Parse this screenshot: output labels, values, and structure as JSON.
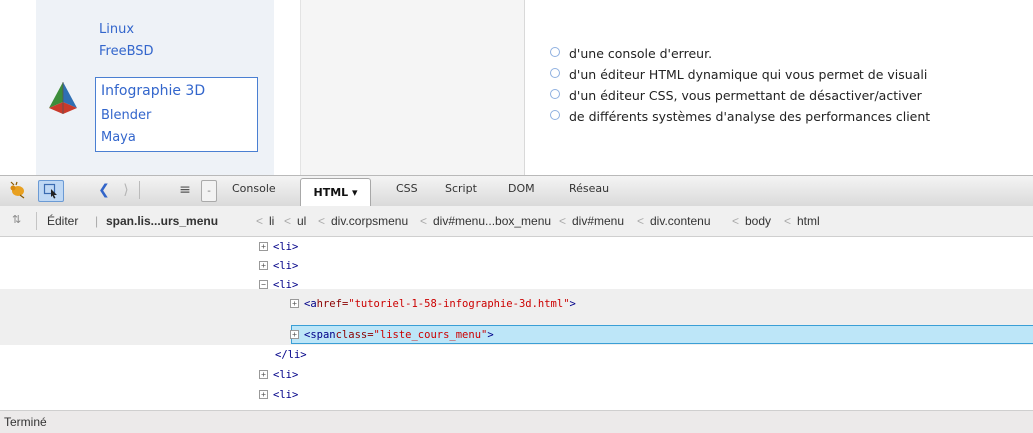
{
  "page": {
    "left_menu": {
      "items_above": [
        "Linux",
        "FreeBSD"
      ],
      "category": {
        "title": "Infographie 3D",
        "items": [
          "Blender",
          "Maya"
        ]
      }
    },
    "bullets": [
      "d'une console d'erreur.",
      "d'un éditeur HTML dynamique qui vous permet de visuali",
      "d'un éditeur CSS, vous permettant de désactiver/activer",
      "de différents systèmes d'analyse des performances client"
    ]
  },
  "toolbar": {
    "tabs": {
      "console": "Console",
      "html": "HTML ▾",
      "css": "CSS",
      "script": "Script",
      "dom": "DOM",
      "network": "Réseau"
    }
  },
  "breadcrumb": {
    "edit": "Éditer",
    "items": [
      "span.lis...urs_menu",
      "li",
      "ul",
      "div.corpsmenu",
      "div#menu...box_menu",
      "div#menu",
      "div.contenu",
      "body",
      "html"
    ]
  },
  "tree": {
    "rows": [
      {
        "type": "collapsed",
        "text": "<li>"
      },
      {
        "type": "collapsed",
        "text": "<li>"
      },
      {
        "type": "expanded",
        "text": "<li>"
      },
      {
        "type": "child",
        "tag_open": "<a ",
        "attr_name": "href=",
        "attr_value": "\"tutoriel-1-58-infographie-3d.html\"",
        "tag_close": ">"
      },
      {
        "type": "child_selected",
        "tag_open": "<span ",
        "attr_name": "class=",
        "attr_value": "\"liste_cours_menu\"",
        "tag_close": ">"
      },
      {
        "type": "close",
        "text": "</li>"
      },
      {
        "type": "collapsed",
        "text": "<li>"
      },
      {
        "type": "collapsed",
        "text": "<li>"
      }
    ]
  },
  "status": {
    "text": "Terminé"
  },
  "colors": {
    "link": "#3366cc",
    "selection": "#bde6f8",
    "selection_border": "#3a9fd6",
    "tag": "#000088",
    "attr_value": "#cc0000"
  }
}
